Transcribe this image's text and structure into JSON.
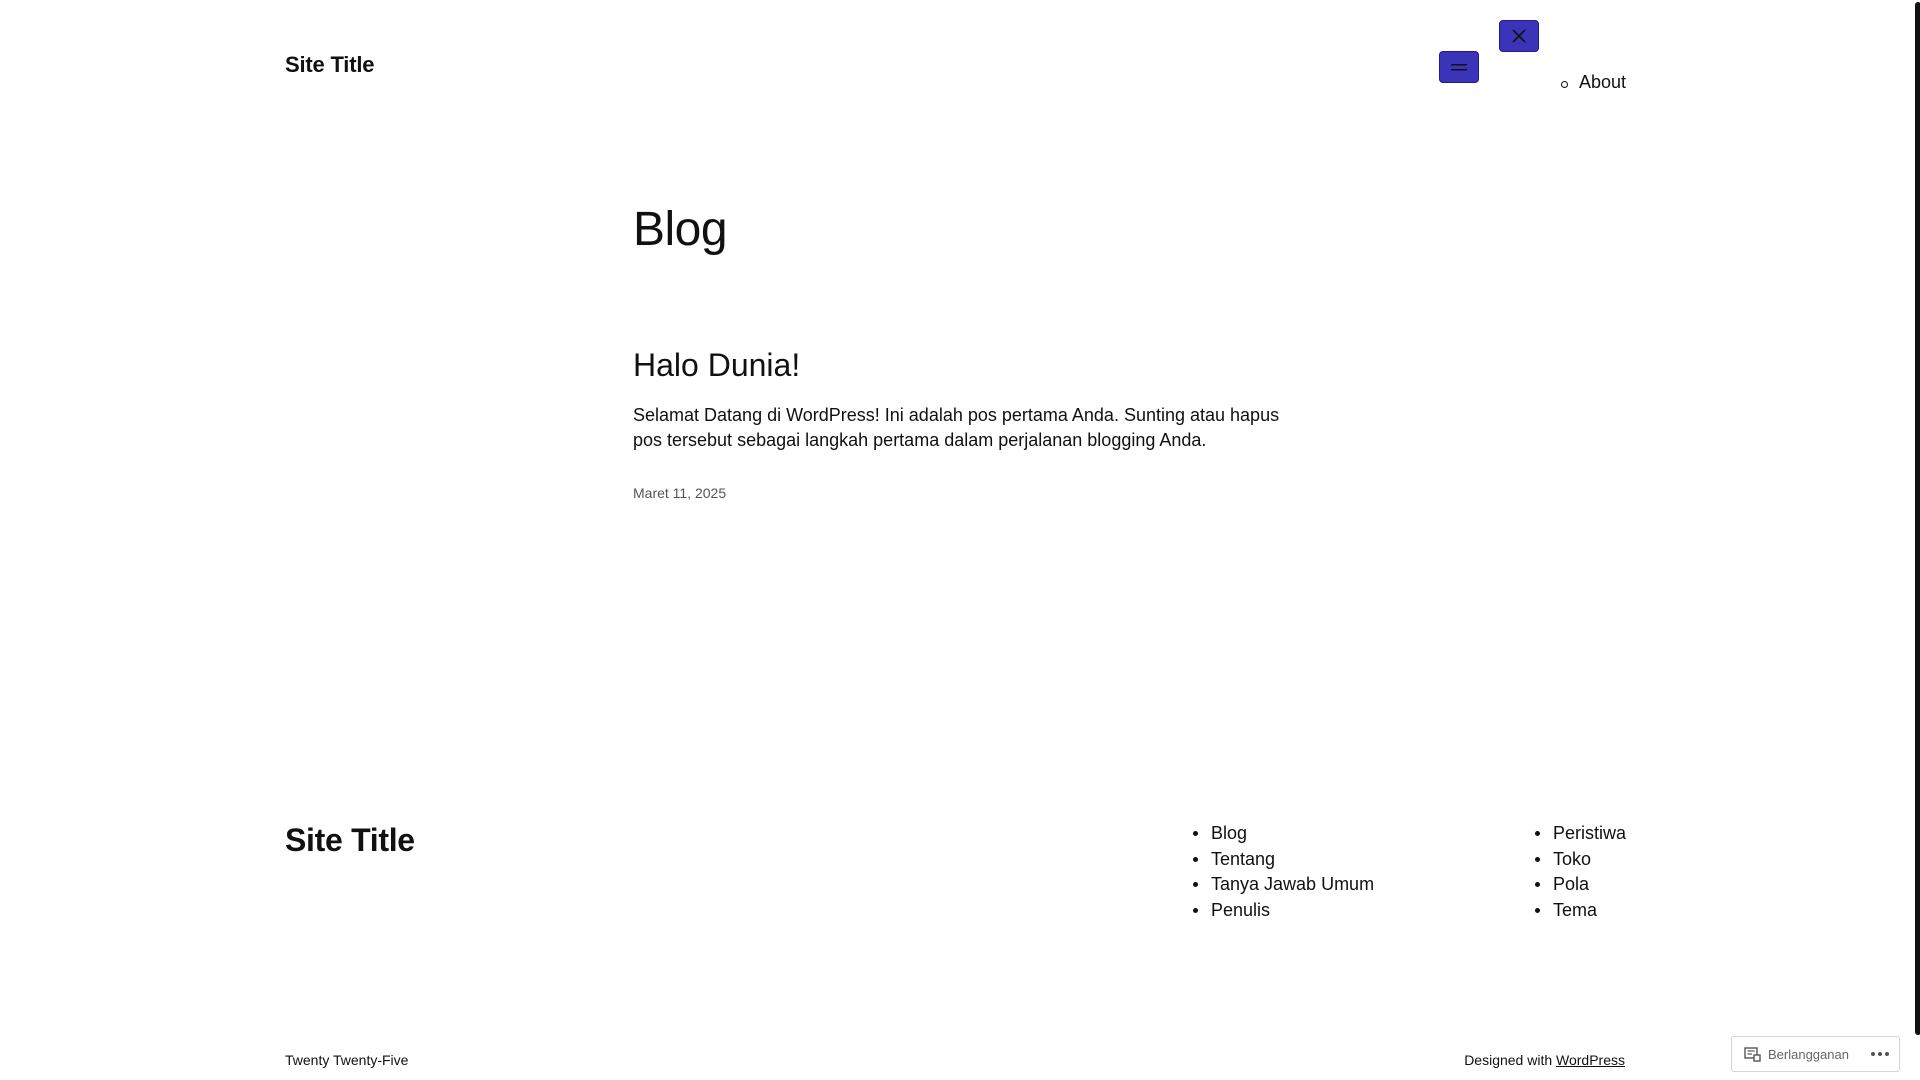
{
  "header": {
    "site_title": "Site Title",
    "nav_items": [
      "About"
    ],
    "open_menu_icon": "menu-icon",
    "close_menu_icon": "close-icon",
    "button_color": "#3b34b8"
  },
  "main": {
    "page_heading": "Blog",
    "posts": [
      {
        "title": "Halo Dunia!",
        "excerpt": "Selamat Datang di WordPress! Ini adalah pos pertama Anda. Sunting atau hapus pos tersebut sebagai langkah pertama dalam perjalanan blogging Anda.",
        "date": "Maret 11, 2025"
      }
    ]
  },
  "footer": {
    "site_title": "Site Title",
    "menu_1": [
      "Blog",
      "Tentang",
      "Tanya Jawab Umum",
      "Penulis"
    ],
    "menu_2": [
      "Peristiwa",
      "Toko",
      "Pola",
      "Tema"
    ],
    "theme_name": "Twenty Twenty-Five",
    "credit_prefix": "Designed with ",
    "credit_link": "WordPress"
  },
  "subscribe_bar": {
    "label": "Berlangganan",
    "icon": "reader-icon",
    "more_icon": "ellipsis-icon"
  }
}
